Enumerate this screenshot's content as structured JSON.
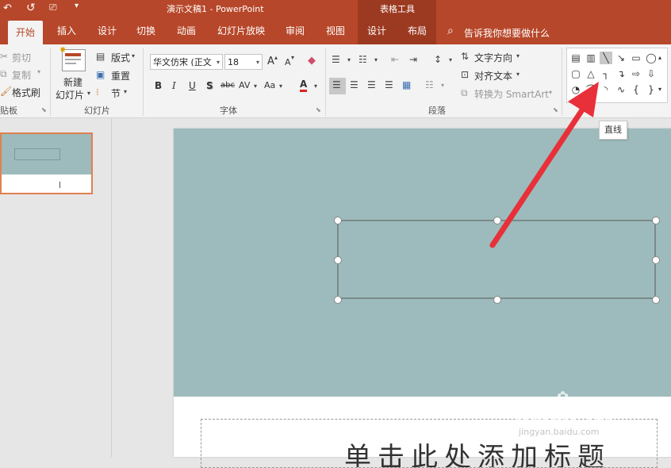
{
  "window": {
    "title": "演示文稿1  -  PowerPoint",
    "context_group": "表格工具",
    "qat_icons": [
      "undo-icon",
      "redo-icon",
      "slideshow-icon",
      "customize-qat-icon"
    ]
  },
  "tabs": [
    "开始",
    "插入",
    "设计",
    "切换",
    "动画",
    "幻灯片放映",
    "审阅",
    "视图",
    "设计",
    "布局"
  ],
  "active_tab": "开始",
  "tell_me": "告诉我你想要做什么",
  "clipboard": {
    "cut": "剪切",
    "copy": "复制",
    "format_painter": "格式刷",
    "group": "贴板"
  },
  "slides_group": {
    "new_slide_line1": "新建",
    "new_slide_line2": "幻灯片",
    "layout": "版式",
    "reset": "重置",
    "section": "节",
    "group": "幻灯片"
  },
  "font_group": {
    "font_name": "华文仿宋 (正文",
    "font_size": "18",
    "grow": "A",
    "shrink": "A",
    "bold": "B",
    "italic": "I",
    "underline": "U",
    "shadow": "S",
    "strike": "abc",
    "spacing": "AV",
    "case": "Aa",
    "color": "A",
    "group": "字体"
  },
  "paragraph_group": {
    "text_direction": "文字方向",
    "align_text": "对齐文本",
    "smartart": "转换为 SmartArt",
    "group": "段落"
  },
  "tooltip": "直线",
  "slide": {
    "title_text": "单击此处添加标题",
    "bg_color": "#9dbbbc"
  },
  "watermark": {
    "brand": "Baidu经验",
    "url": "jingyan.baidu.com"
  },
  "colors": {
    "accent": "#b7472a",
    "arrow": "#e8303a"
  }
}
